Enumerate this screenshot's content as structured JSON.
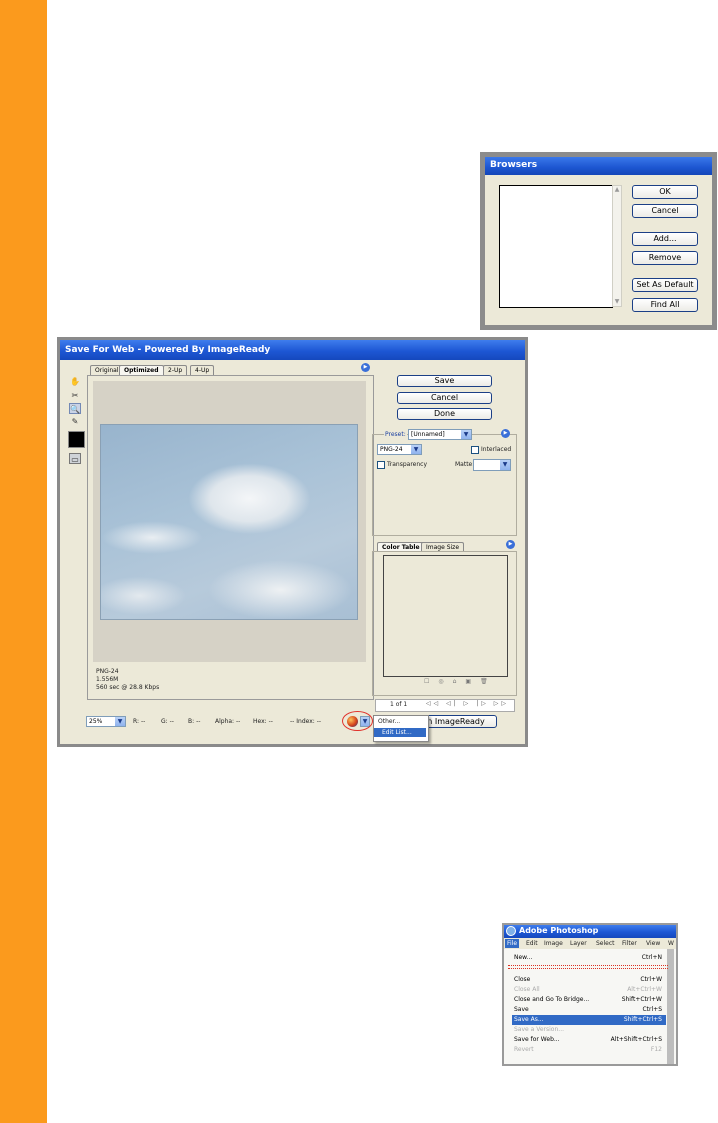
{
  "browsers_dialog": {
    "title": "Browsers",
    "buttons": [
      "OK",
      "Cancel",
      "Add...",
      "Remove",
      "Set As Default",
      "Find All"
    ]
  },
  "save_for_web": {
    "title": "Save For Web - Powered By ImageReady",
    "tabs": [
      "Original",
      "Optimized",
      "2-Up",
      "4-Up"
    ],
    "buttons": {
      "save": "Save",
      "cancel": "Cancel",
      "done": "Done"
    },
    "preset": {
      "label": "Preset:",
      "value": "[Unnamed]"
    },
    "format": "PNG-24",
    "interlaced_label": "Interlaced",
    "transparency_label": "Transparency",
    "matte_label": "Matte:",
    "bottom_tabs": [
      "Color Table",
      "Image Size"
    ],
    "image_info": [
      "PNG-24",
      "1.556M",
      "560 sec @ 28.8 Kbps"
    ],
    "zoom": "25%",
    "status": {
      "r": "R:",
      "r_val": "--",
      "g": "G:",
      "g_val": "--",
      "b": "B:",
      "b_val": "--",
      "alpha": "Alpha:",
      "alpha_val": "--",
      "hex": "Hex:",
      "hex_val": "--",
      "index": "Index:",
      "index_val": "--"
    },
    "paging": "1 of 1",
    "preview_button": "in ImageReady",
    "browser_menu": [
      "Other...",
      "Edit List..."
    ]
  },
  "photoshop_menu": {
    "title": "Adobe Photoshop",
    "menubar": [
      "File",
      "Edit",
      "Image",
      "Layer",
      "Select",
      "Filter",
      "View",
      "W"
    ],
    "items": [
      {
        "label": "New...",
        "shortcut": "Ctrl+N",
        "disabled": false
      },
      {
        "label": "Close",
        "shortcut": "Ctrl+W",
        "disabled": false
      },
      {
        "label": "Close All",
        "shortcut": "Alt+Ctrl+W",
        "disabled": true
      },
      {
        "label": "Close and Go To Bridge...",
        "shortcut": "Shift+Ctrl+W",
        "disabled": false
      },
      {
        "label": "Save",
        "shortcut": "Ctrl+S",
        "disabled": false
      },
      {
        "label": "Save As...",
        "shortcut": "Shift+Ctrl+S",
        "disabled": false,
        "highlighted": true
      },
      {
        "label": "Save a Version...",
        "shortcut": "",
        "disabled": true
      },
      {
        "label": "Save for Web...",
        "shortcut": "Alt+Shift+Ctrl+S",
        "disabled": false
      },
      {
        "label": "Revert",
        "shortcut": "F12",
        "disabled": true
      }
    ]
  }
}
